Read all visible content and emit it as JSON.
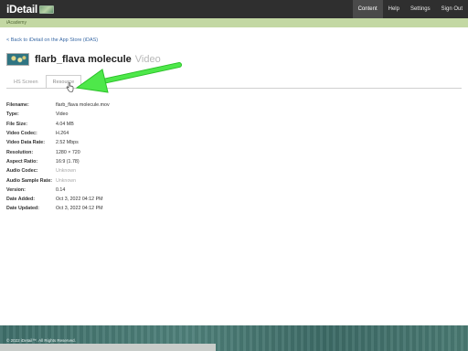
{
  "header": {
    "logo_text": "iDetail",
    "nav": [
      {
        "label": "Content",
        "active": true
      },
      {
        "label": "Help",
        "active": false
      },
      {
        "label": "Settings",
        "active": false
      },
      {
        "label": "Sign Out",
        "active": false
      }
    ]
  },
  "subbar": {
    "text": "iAcademy"
  },
  "back_link": "< Back to iDetail on the App Store (iDAS)",
  "asset": {
    "title": "flarb_flava molecule",
    "type_label": "Video"
  },
  "tabs": [
    {
      "label": "HS Screen",
      "active": false
    },
    {
      "label": "Resource",
      "active": true
    }
  ],
  "details": [
    {
      "label": "Filename:",
      "value": "flarb_flava molecule.mov",
      "muted": false
    },
    {
      "label": "Type:",
      "value": "Video",
      "muted": false
    },
    {
      "label": "File Size:",
      "value": "4.04 MB",
      "muted": false
    },
    {
      "label": "Video Codec:",
      "value": "H.264",
      "muted": false
    },
    {
      "label": "Video Data Rate:",
      "value": "2.52 Mbps",
      "muted": false
    },
    {
      "label": "Resolution:",
      "value": "1280 × 720",
      "muted": false
    },
    {
      "label": "Aspect Ratio:",
      "value": "16:9 (1.78)",
      "muted": false
    },
    {
      "label": "Audio Codec:",
      "value": "Unknown",
      "muted": true
    },
    {
      "label": "Audio Sample Rate:",
      "value": "Unknown",
      "muted": true
    },
    {
      "label": "Version:",
      "value": "0.14",
      "muted": false
    },
    {
      "label": "Date Added:",
      "value": "Oct 3, 2022 04:12 PM",
      "muted": false
    },
    {
      "label": "Date Updated:",
      "value": "Oct 3, 2022 04:12 PM",
      "muted": false
    }
  ],
  "footer": {
    "text": "© 2022 iDetail™. All Rights Reserved."
  },
  "colors": {
    "topbar": "#2f2f2f",
    "subbar": "#c3d8a3",
    "link": "#3a6aa6",
    "annotation_arrow": "#3fdc3a",
    "footer": "#4a7a73"
  }
}
